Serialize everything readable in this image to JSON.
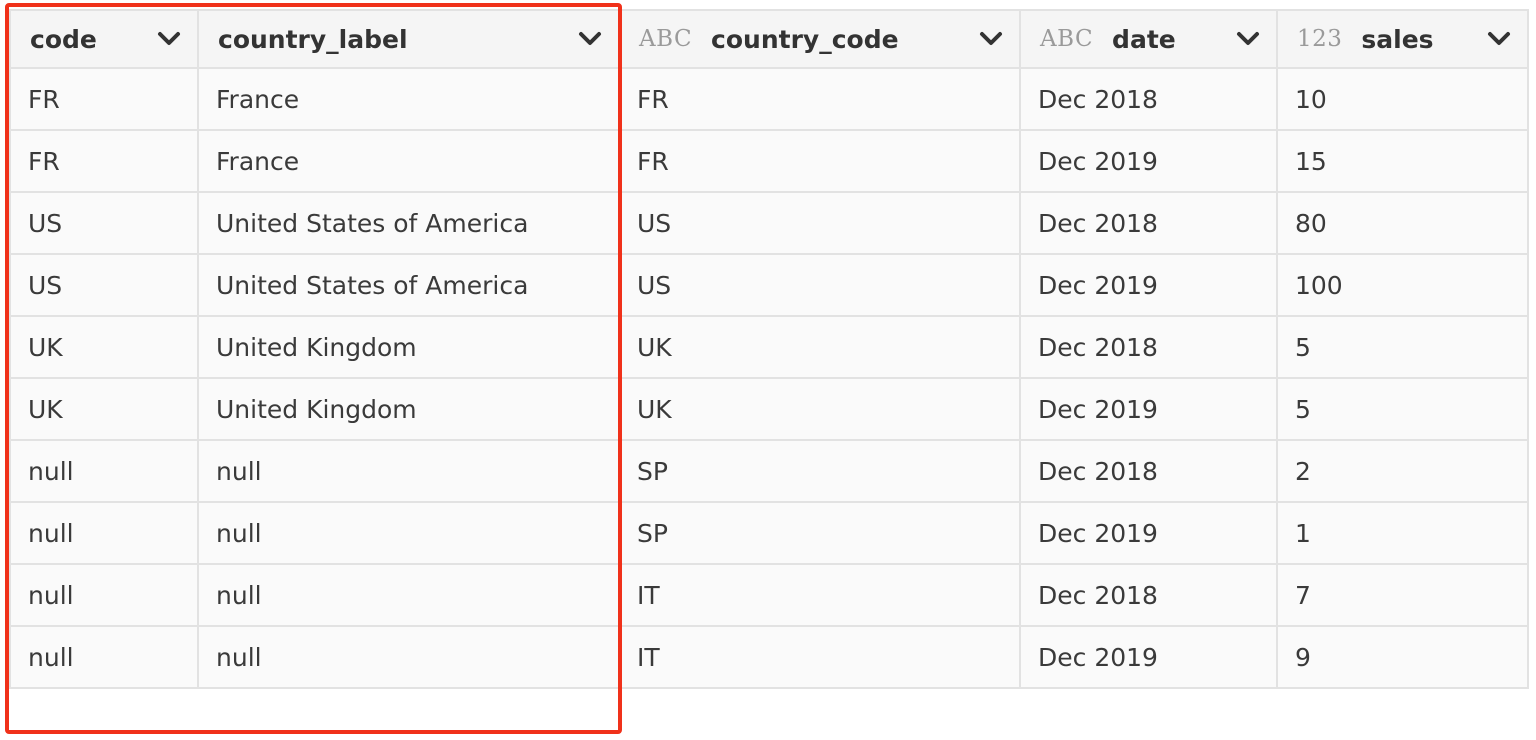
{
  "columns": [
    {
      "name": "code",
      "type_tag": ""
    },
    {
      "name": "country_label",
      "type_tag": ""
    },
    {
      "name": "country_code",
      "type_tag": "ABC"
    },
    {
      "name": "date",
      "type_tag": "ABC"
    },
    {
      "name": "sales",
      "type_tag": "123"
    }
  ],
  "rows": [
    [
      "FR",
      "France",
      "FR",
      "Dec 2018",
      "10"
    ],
    [
      "FR",
      "France",
      "FR",
      "Dec 2019",
      "15"
    ],
    [
      "US",
      "United States of America",
      "US",
      "Dec 2018",
      "80"
    ],
    [
      "US",
      "United States of America",
      "US",
      "Dec 2019",
      "100"
    ],
    [
      "UK",
      "United Kingdom",
      "UK",
      "Dec 2018",
      "5"
    ],
    [
      "UK",
      "United Kingdom",
      "UK",
      "Dec 2019",
      "5"
    ],
    [
      "null",
      "null",
      "SP",
      "Dec 2018",
      "2"
    ],
    [
      "null",
      "null",
      "SP",
      "Dec 2019",
      "1"
    ],
    [
      "null",
      "null",
      "IT",
      "Dec 2018",
      "7"
    ],
    [
      "null",
      "null",
      "IT",
      "Dec 2019",
      "9"
    ]
  ],
  "colors": {
    "highlight": "#f0311a",
    "header_bg": "#f5f5f5",
    "cell_bg": "#fafafa",
    "border": "#e2e2e2"
  }
}
